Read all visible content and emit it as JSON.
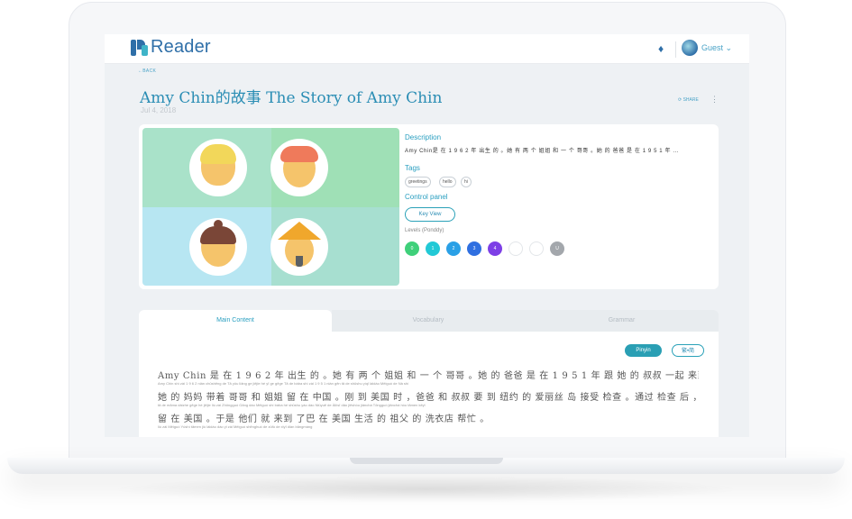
{
  "app": {
    "brand": "Reader",
    "user": "Guest"
  },
  "nav": {
    "back": "←BACK",
    "share": "SHARE"
  },
  "article": {
    "title": "Amy Chin的故事 The Story of Amy Chin",
    "date": "Jul 4, 2018"
  },
  "details": {
    "description_label": "Description",
    "description": "Amy Chin是 在 1 9 6 2 年 出生 的 。她 有 两 个 姐姐 和 一 个 哥哥 。她 的 爸爸 是 在 1 9 5 1 年 ...",
    "tags_label": "Tags",
    "tags": [
      "greetings",
      "hello",
      "hi"
    ],
    "control_label": "Control panel",
    "key_view": "Key View",
    "levels_label": "Levels (Ponddy)",
    "levels": [
      {
        "label": "0",
        "color": "#3fd07a"
      },
      {
        "label": "1",
        "color": "#22c9d6"
      },
      {
        "label": "2",
        "color": "#2aa0e6"
      },
      {
        "label": "3",
        "color": "#2f6fe0"
      },
      {
        "label": "4",
        "color": "#7d3fe6"
      },
      {
        "label": "",
        "color": "#ffffff"
      },
      {
        "label": "",
        "color": "#ffffff"
      },
      {
        "label": "U",
        "color": "#a3a7ac"
      }
    ]
  },
  "tabs": [
    "Main Content",
    "Vocabulary",
    "Grammar"
  ],
  "reader": {
    "pinyin_btn": "Pinyin",
    "trad_btn": "繁•简",
    "lines": [
      "Amy Chin 是 在 1 9 6 2 年 出生 的 。她 有 两 个 姐姐 和 一 个 哥哥 。她 的 爸爸 是 在 1 9 5 1 年 跟 她 的 叔叔 一起 来到 美国 的 。那时",
      "她 的 妈妈 带着 哥哥 和 姐姐 留 在 中国 。刚 到 美国 时 ，爸爸 和 叔叔 要 到 纽约 的 爱丽丝 岛 接受 检查 。通过 检查 后 ，他们 可以",
      "留 在 美国 。于是 他们 就 来到 了巴 在 美国 生活 的 祖父 的 洗衣店 帮忙 。"
    ],
    "pinyin": [
      "Amy   Chin   shì   zài   1   9   6   2   nián  chūshēng  de    Tā  yǒu  liǎng  ge   jiějie    hé   yī   ge   gēge      Tā   de   bàba   shì   zài   1   9   5   1  nián  gēn   tā   de   shūshu   yìqǐ   láidào  Měiguó  de     Nà  shí",
      "tā   de   māma   dàizhe   gēge   hé   jiějie   liú   zài  Zhōngguó    Gāng  dào  Měiguó  shí     bàba   hé   shūshu  yào  dào  Niǔyuē  de      Àilìsī    dǎo  jiēshòu   jiǎnchá      Tōngguò  jiǎnchá  hòu    tāmen    kěyǐ",
      "liú   zài   Měiguó      Yúshì    tāmen    jiù    láidào   dào  yǐ   zài  Měiguó  shēnghuó   de     zǔfù     de    xǐyī     diàn bāngmáng"
    ]
  }
}
